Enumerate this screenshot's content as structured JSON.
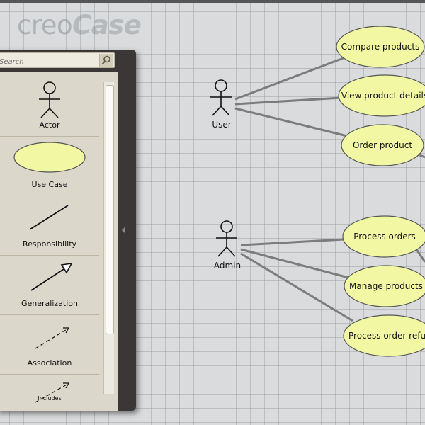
{
  "app": {
    "logo_part1": "creo",
    "logo_part2": "Case"
  },
  "palette": {
    "search_placeholder": "Search",
    "items": [
      {
        "label": "Actor",
        "icon": "actor-icon"
      },
      {
        "label": "Use Case",
        "icon": "use-case-icon"
      },
      {
        "label": "Responsibility",
        "icon": "responsibility-icon"
      },
      {
        "label": "Generalization",
        "icon": "generalization-icon"
      },
      {
        "label": "Association",
        "icon": "association-icon"
      },
      {
        "label": "Includes",
        "icon": "includes-icon"
      }
    ]
  },
  "diagram": {
    "actors": [
      {
        "name": "User"
      },
      {
        "name": "Admin"
      }
    ],
    "use_cases": [
      {
        "label": "Compare products",
        "actor": "User"
      },
      {
        "label": "View product details",
        "actor": "User"
      },
      {
        "label": "Order product",
        "actor": "User"
      },
      {
        "label": "Process orders",
        "actor": "Admin"
      },
      {
        "label": "Manage products",
        "actor": "Admin"
      },
      {
        "label": "Process order refund",
        "actor": "Admin"
      }
    ]
  },
  "colors": {
    "use_case_fill": "#f1f7a2",
    "use_case_stroke": "#555555",
    "connector": "#7a7c7e"
  }
}
